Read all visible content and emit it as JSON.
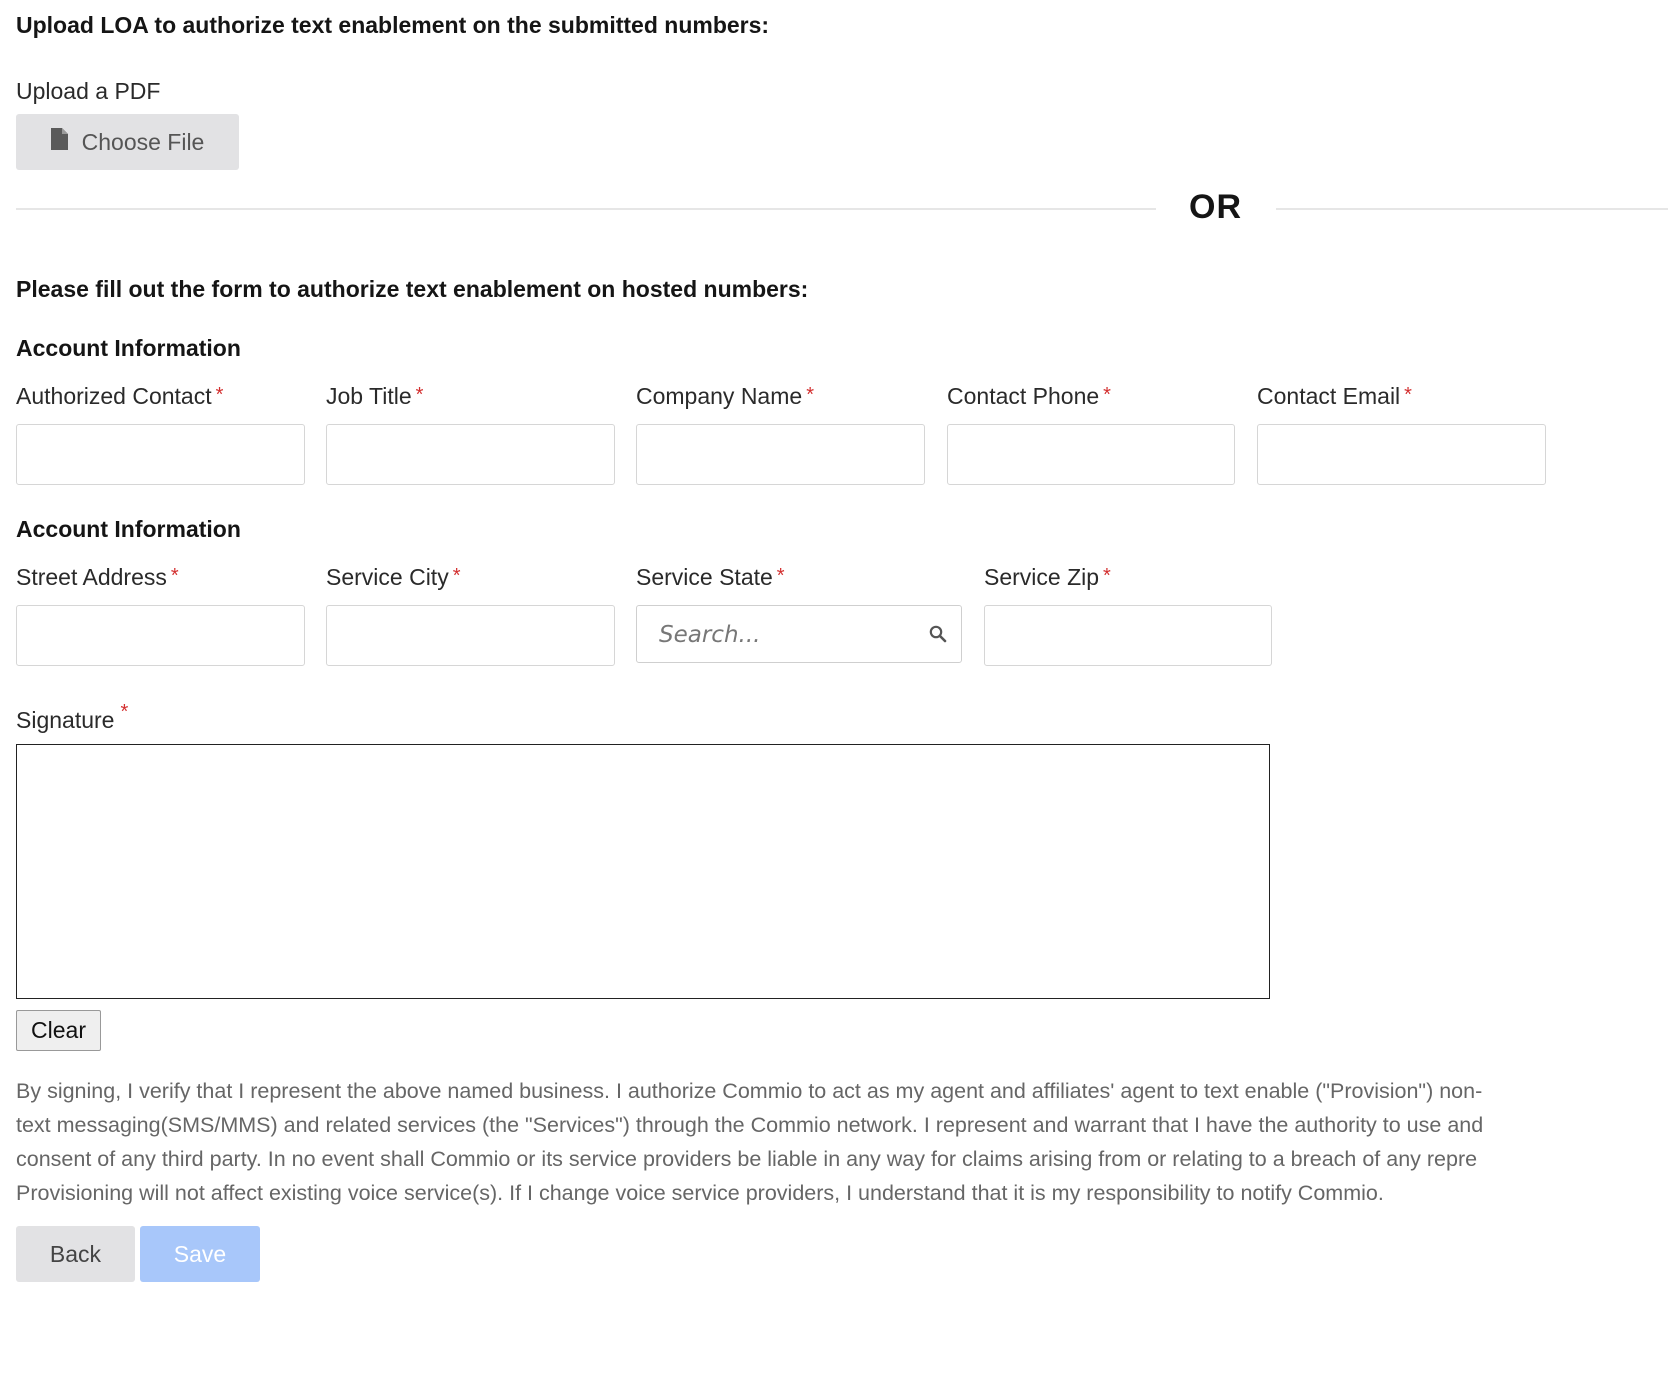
{
  "upload": {
    "heading": "Upload LOA to authorize text enablement on the submitted numbers:",
    "label": "Upload a PDF",
    "button_label": "Choose File",
    "button_icon": "file-icon"
  },
  "divider": {
    "text": "OR"
  },
  "form": {
    "heading": "Please fill out the form to authorize text enablement on hosted numbers:",
    "account_section": {
      "title": "Account Information",
      "fields": [
        {
          "label": "Authorized Contact",
          "value": ""
        },
        {
          "label": "Job Title",
          "value": ""
        },
        {
          "label": "Company Name",
          "value": ""
        },
        {
          "label": "Contact Phone",
          "value": ""
        },
        {
          "label": "Contact Email",
          "value": ""
        }
      ]
    },
    "address_section": {
      "title": "Account Information",
      "street_label": "Street Address",
      "city_label": "Service City",
      "state_label": "Service State",
      "state_placeholder": "Search...",
      "zip_label": "Service Zip"
    },
    "required_marker": "*",
    "signature": {
      "label": "Signature",
      "clear_label": "Clear"
    },
    "terms_lines": [
      "By signing, I verify that I represent the above named business. I authorize Commio to act as my agent and affiliates' agent to text enable (\"Provision\") non-",
      "text messaging(SMS/MMS) and related services (the \"Services\") through the Commio network. I represent and warrant that I have the authority to use and",
      "consent of any third party. In no event shall Commio or its service providers be liable in any way for claims arising from or relating to a breach of any repre",
      "Provisioning will not affect existing voice service(s). If I change voice service providers, I understand that it is my responsibility to notify Commio."
    ]
  },
  "actions": {
    "back_label": "Back",
    "save_label": "Save"
  },
  "colors": {
    "required": "#d32f2f",
    "save_disabled": "#a8c7fa",
    "button_gray": "#e2e2e4"
  }
}
